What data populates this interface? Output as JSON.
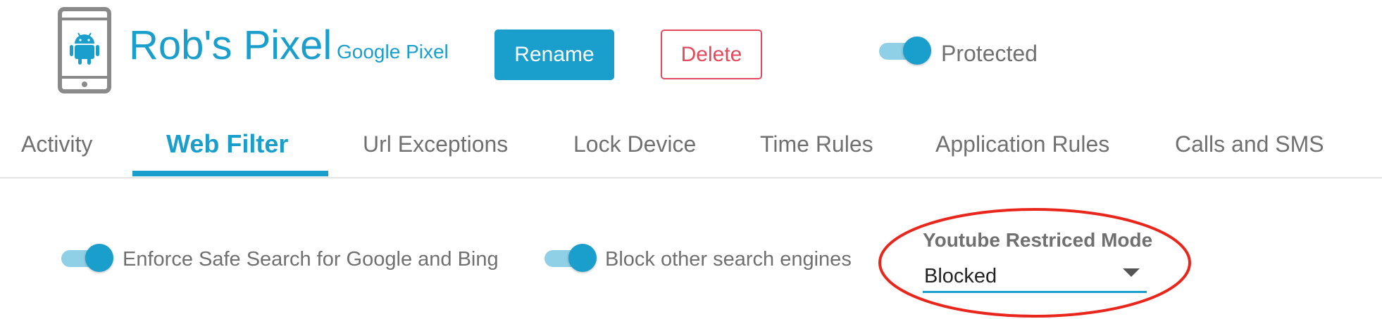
{
  "header": {
    "device_icon": "android-phone-icon",
    "device_name": "Rob's Pixel",
    "device_model": "Google Pixel",
    "rename_label": "Rename",
    "delete_label": "Delete",
    "protected_label": "Protected",
    "protected_on": true
  },
  "tabs": [
    {
      "label": "Activity",
      "active": false
    },
    {
      "label": "Web Filter",
      "active": true
    },
    {
      "label": "Url Exceptions",
      "active": false
    },
    {
      "label": "Lock Device",
      "active": false
    },
    {
      "label": "Time Rules",
      "active": false
    },
    {
      "label": "Application Rules",
      "active": false
    },
    {
      "label": "Calls and SMS",
      "active": false
    }
  ],
  "web_filter": {
    "safe_search_label": "Enforce Safe Search for Google and Bing",
    "safe_search_on": true,
    "block_engines_label": "Block other search engines",
    "block_engines_on": true,
    "youtube_label": "Youtube Restriced Mode",
    "youtube_value": "Blocked"
  },
  "colors": {
    "accent": "#1a9fcd",
    "toggle_track": "#8fd0e6",
    "delete": "#e24a5b",
    "highlight": "#e8261c",
    "text": "#707070",
    "divider": "#e3e3e3"
  }
}
